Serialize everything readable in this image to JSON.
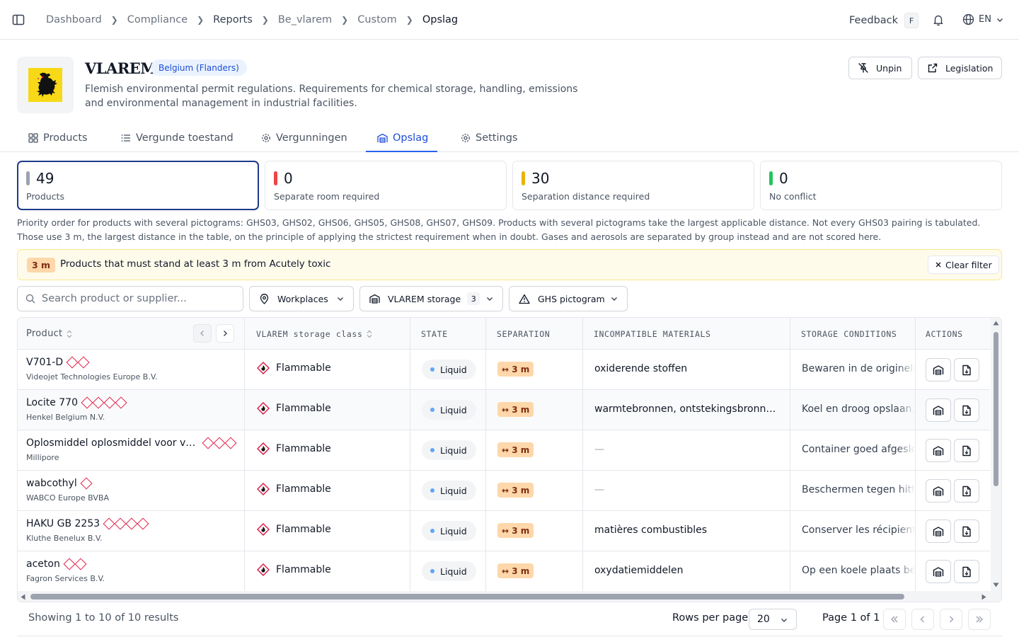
{
  "breadcrumb": [
    "Dashboard",
    "Compliance",
    "Reports",
    "Be_vlarem",
    "Custom",
    "Opslag"
  ],
  "topbar": {
    "feedback": "Feedback",
    "feedback_key": "F",
    "language": "EN"
  },
  "header": {
    "title": "VLAREM",
    "region": "Belgium (Flanders)",
    "description": "Flemish environmental permit regulations. Requirements for chemical storage, handling, emissions and environmental management in industrial facilities.",
    "unpin": "Unpin",
    "legislation": "Legislation"
  },
  "tabs": [
    "Products",
    "Vergunde toestand",
    "Vergunningen",
    "Opslag",
    "Settings"
  ],
  "active_tab": "Opslag",
  "stats": [
    {
      "value": "49",
      "label": "Products",
      "color": "#9ca3af"
    },
    {
      "value": "0",
      "label": "Separate room required",
      "color": "#ef4444"
    },
    {
      "value": "30",
      "label": "Separation distance required",
      "color": "#eab308"
    },
    {
      "value": "0",
      "label": "No conflict",
      "color": "#22c55e"
    }
  ],
  "note": "Priority order for products with several pictograms: GHS03, GHS02, GHS06, GHS05, GHS08, GHS07, GHS09. Products with several pictograms take the largest applicable distance. Not every GHS03 pairing is tabulated. Those use 3 m, the largest distance in the table, on the principle of applying the strictest requirement when in doubt. Gases and aerosols are separated by group instead and are not scored here.",
  "filter_banner": {
    "distance": "3 m",
    "text": "Products that must stand at least 3 m from Acutely toxic",
    "clear": "Clear filter"
  },
  "filters": {
    "search_placeholder": "Search product or supplier...",
    "workplaces": "Workplaces",
    "storage": "VLAREM storage",
    "storage_count": "3",
    "ghs": "GHS pictogram"
  },
  "table": {
    "headers": [
      "Product",
      "VLAREM storage class",
      "STATE",
      "SEPARATION",
      "INCOMPATIBLE MATERIALS",
      "STORAGE CONDITIONS",
      "ACTIONS"
    ],
    "rows": [
      {
        "name": "V701-D",
        "supplier": "Videojet Technologies Europe B.V.",
        "pictograms": 2,
        "class": "Flammable",
        "state": "Liquid",
        "separation": "↔ 3 m",
        "incompatible": "oxiderende stoffen",
        "storage": "Bewaren in de originele verpakking"
      },
      {
        "name": "Locite 770",
        "supplier": "Henkel Belgium N.V.",
        "pictograms": 4,
        "class": "Flammable",
        "state": "Liquid",
        "separation": "↔ 3 m",
        "incompatible": "warmtebronnen, ontstekingsbronnen…",
        "storage": "Koel en droog opslaan."
      },
      {
        "name": "Oplosmiddel oplosmiddel voor vol…",
        "supplier": "Millipore",
        "pictograms": 3,
        "class": "Flammable",
        "state": "Liquid",
        "separation": "↔ 3 m",
        "incompatible": "—",
        "storage": "Container goed afgesloten houden"
      },
      {
        "name": "wabcothyl",
        "supplier": "WABCO Europe BVBA",
        "pictograms": 1,
        "class": "Flammable",
        "state": "Liquid",
        "separation": "↔ 3 m",
        "incompatible": "—",
        "storage": "Beschermen tegen hitte"
      },
      {
        "name": "HAKU GB 2253",
        "supplier": "Kluthe Benelux B.V.",
        "pictograms": 4,
        "class": "Flammable",
        "state": "Liquid",
        "separation": "↔ 3 m",
        "incompatible": "matières combustibles",
        "storage": "Conserver les récipients fermés"
      },
      {
        "name": "aceton",
        "supplier": "Fagron Services B.V.",
        "pictograms": 2,
        "class": "Flammable",
        "state": "Liquid",
        "separation": "↔ 3 m",
        "incompatible": "oxydatiemiddelen",
        "storage": "Op een koele plaats bewaren"
      }
    ]
  },
  "footer": {
    "showing": "Showing 1 to 10 of 10 results",
    "rows_per_page_label": "Rows per page",
    "rows_per_page": "20",
    "page_info": "Page 1 of 1"
  }
}
